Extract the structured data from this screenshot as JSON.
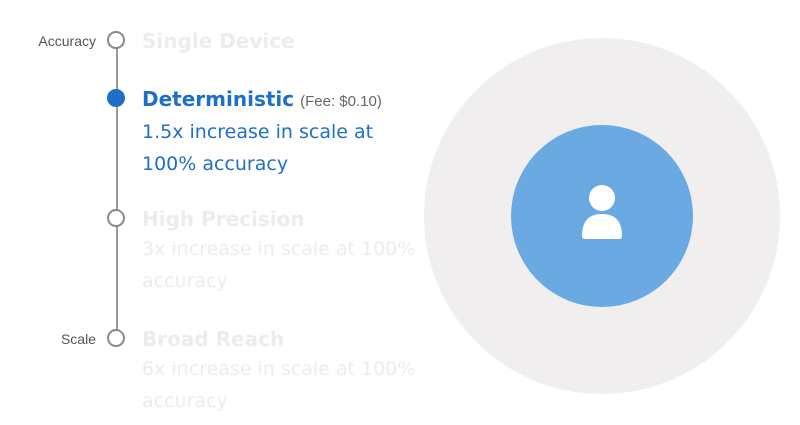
{
  "axis": {
    "top_label": "Accuracy",
    "bottom_label": "Scale"
  },
  "options": [
    {
      "title": "Single Device",
      "fee": "",
      "description": "",
      "state": "dimmed"
    },
    {
      "title": "Deterministic",
      "fee": "(Fee: $0.10)",
      "description": "1.5x increase in scale at 100% accuracy",
      "state": "selected"
    },
    {
      "title": "High Precision",
      "fee": "",
      "description": "3x increase in scale at 100% accuracy",
      "state": "dimmed"
    },
    {
      "title": "Broad Reach",
      "fee": "",
      "description": "6x increase in scale at 100% accuracy",
      "state": "dimmed"
    }
  ],
  "visual": {
    "icon": "user-icon",
    "outer_color": "#f0eeef",
    "inner_color": "#6aa9e2"
  },
  "colors": {
    "accent": "#1e6fc5",
    "dimmed_text": "#ececec",
    "track": "#9a9a9a"
  }
}
